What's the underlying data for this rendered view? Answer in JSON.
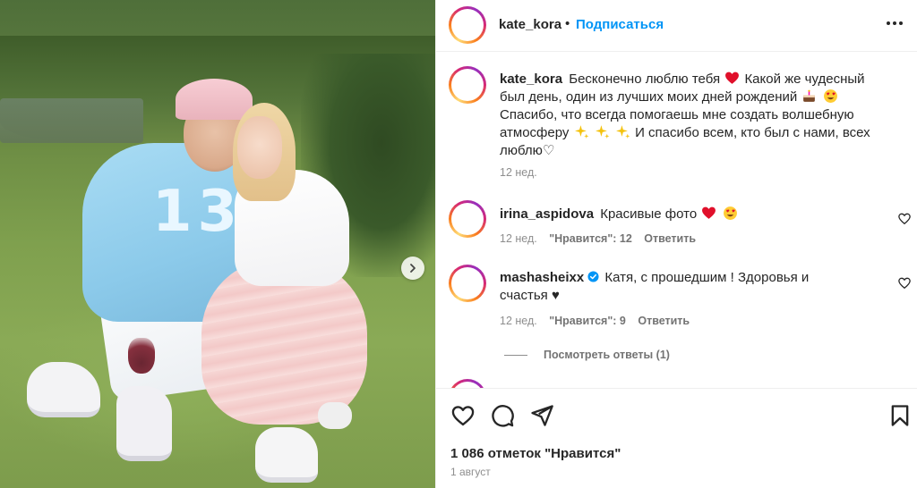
{
  "post": {
    "username": "kate_kora",
    "separator": "•",
    "follow_label": "Подписаться",
    "more_icon": "more-horizontal-icon",
    "next_icon": "chevron-right-icon",
    "photo_number_text": "13"
  },
  "caption": {
    "username": "kate_kora",
    "part1": "Бесконечно люблю тебя",
    "part2": "Какой же чудесный был день, один из лучших моих дней рождений",
    "part3": "Спасибо, что всегда помогаешь мне создать волшебную атмосферу",
    "part4": "И спасибо всем, кто был с нами, всех люблю♡",
    "time": "12 нед."
  },
  "comments": [
    {
      "username": "irina_aspidova",
      "text": "Красивые фото",
      "time": "12 нед.",
      "likes": "\"Нравится\": 12",
      "reply": "Ответить"
    },
    {
      "username": "mashasheixx",
      "verified": true,
      "text": "Катя, с прошедшим ! Здоровья и счастья ♥",
      "time": "12 нед.",
      "likes": "\"Нравится\": 9",
      "reply": "Ответить"
    }
  ],
  "view_replies": "Посмотреть ответы (1)",
  "actions": {
    "like_icon": "heart-icon",
    "comment_icon": "comment-icon",
    "share_icon": "share-icon",
    "save_icon": "bookmark-icon"
  },
  "likes_text": "1 086 отметок \"Нравится\"",
  "date_text": "1 август",
  "colors": {
    "link": "#0095f6",
    "text": "#262626",
    "muted": "#8e8e8e",
    "border": "#efefef"
  }
}
